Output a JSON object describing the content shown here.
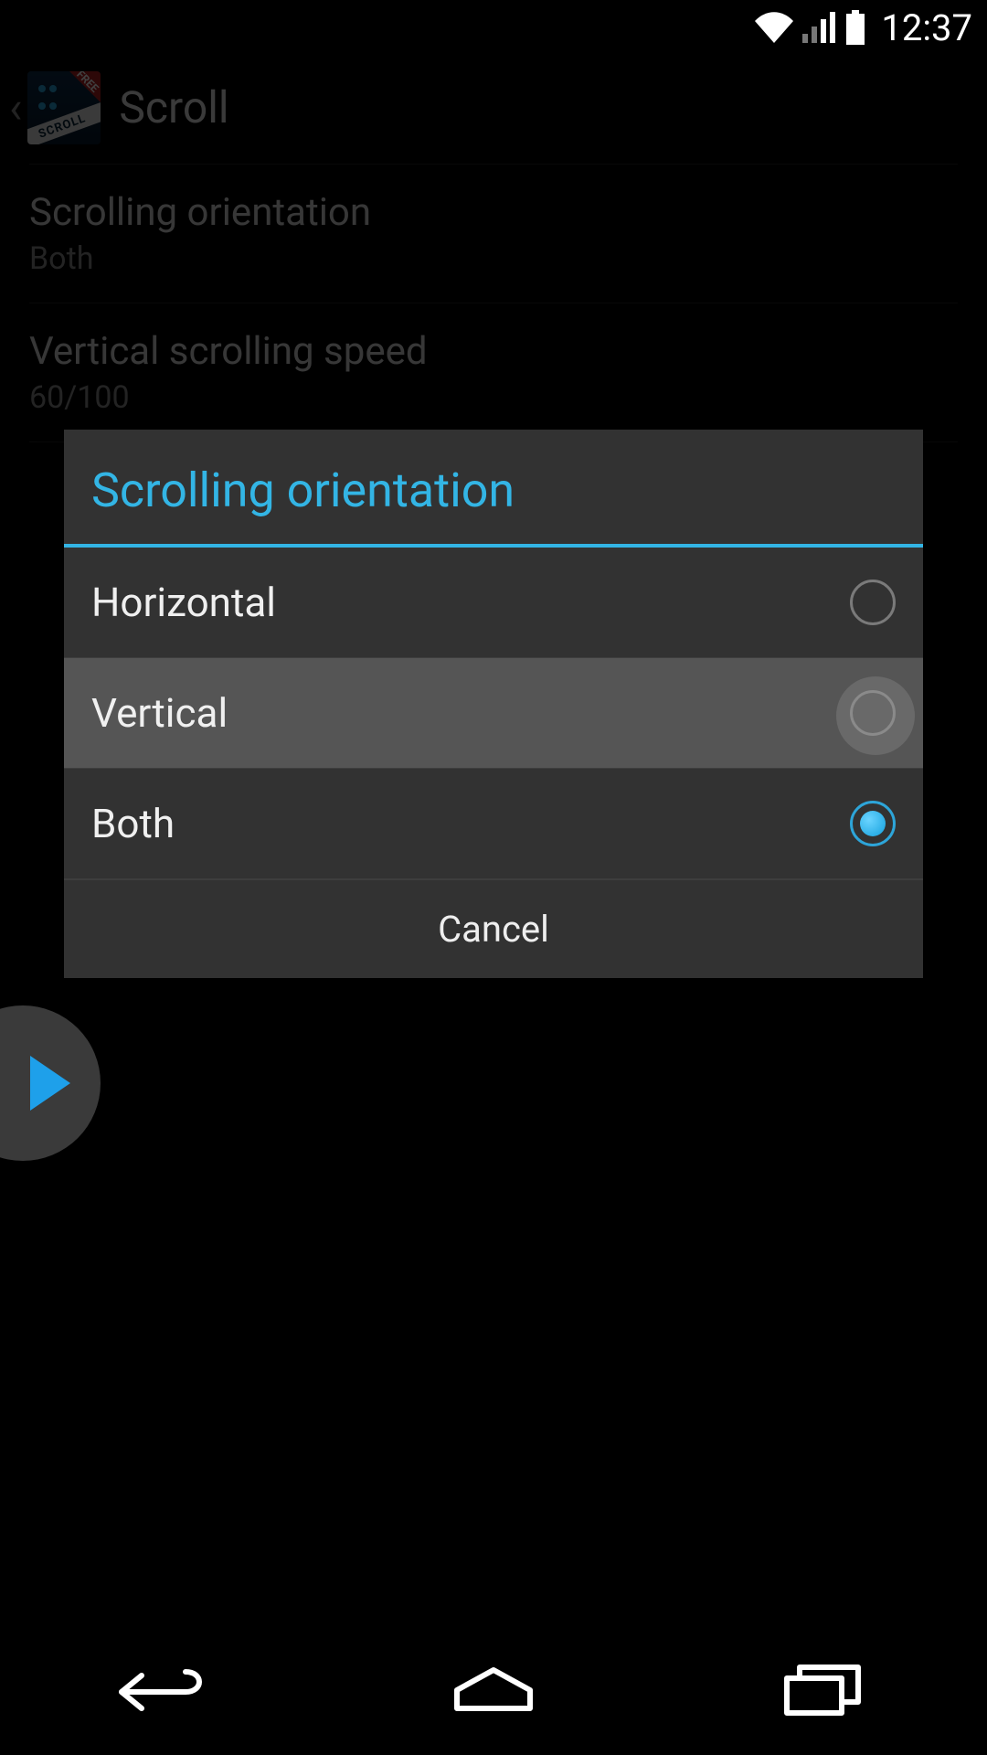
{
  "status": {
    "time": "12:37"
  },
  "header": {
    "title": "Scroll",
    "app_icon_badge": "FREE",
    "app_icon_band": "SCROLL"
  },
  "settings": {
    "items": [
      {
        "label": "Scrolling orientation",
        "value": "Both"
      },
      {
        "label": "Vertical scrolling speed",
        "value": "60/100"
      }
    ]
  },
  "dialog": {
    "title": "Scrolling orientation",
    "options": [
      {
        "label": "Horizontal",
        "selected": false,
        "pressed": false
      },
      {
        "label": "Vertical",
        "selected": false,
        "pressed": true
      },
      {
        "label": "Both",
        "selected": true,
        "pressed": false
      }
    ],
    "cancel_label": "Cancel"
  },
  "colors": {
    "accent": "#33b5e5"
  }
}
